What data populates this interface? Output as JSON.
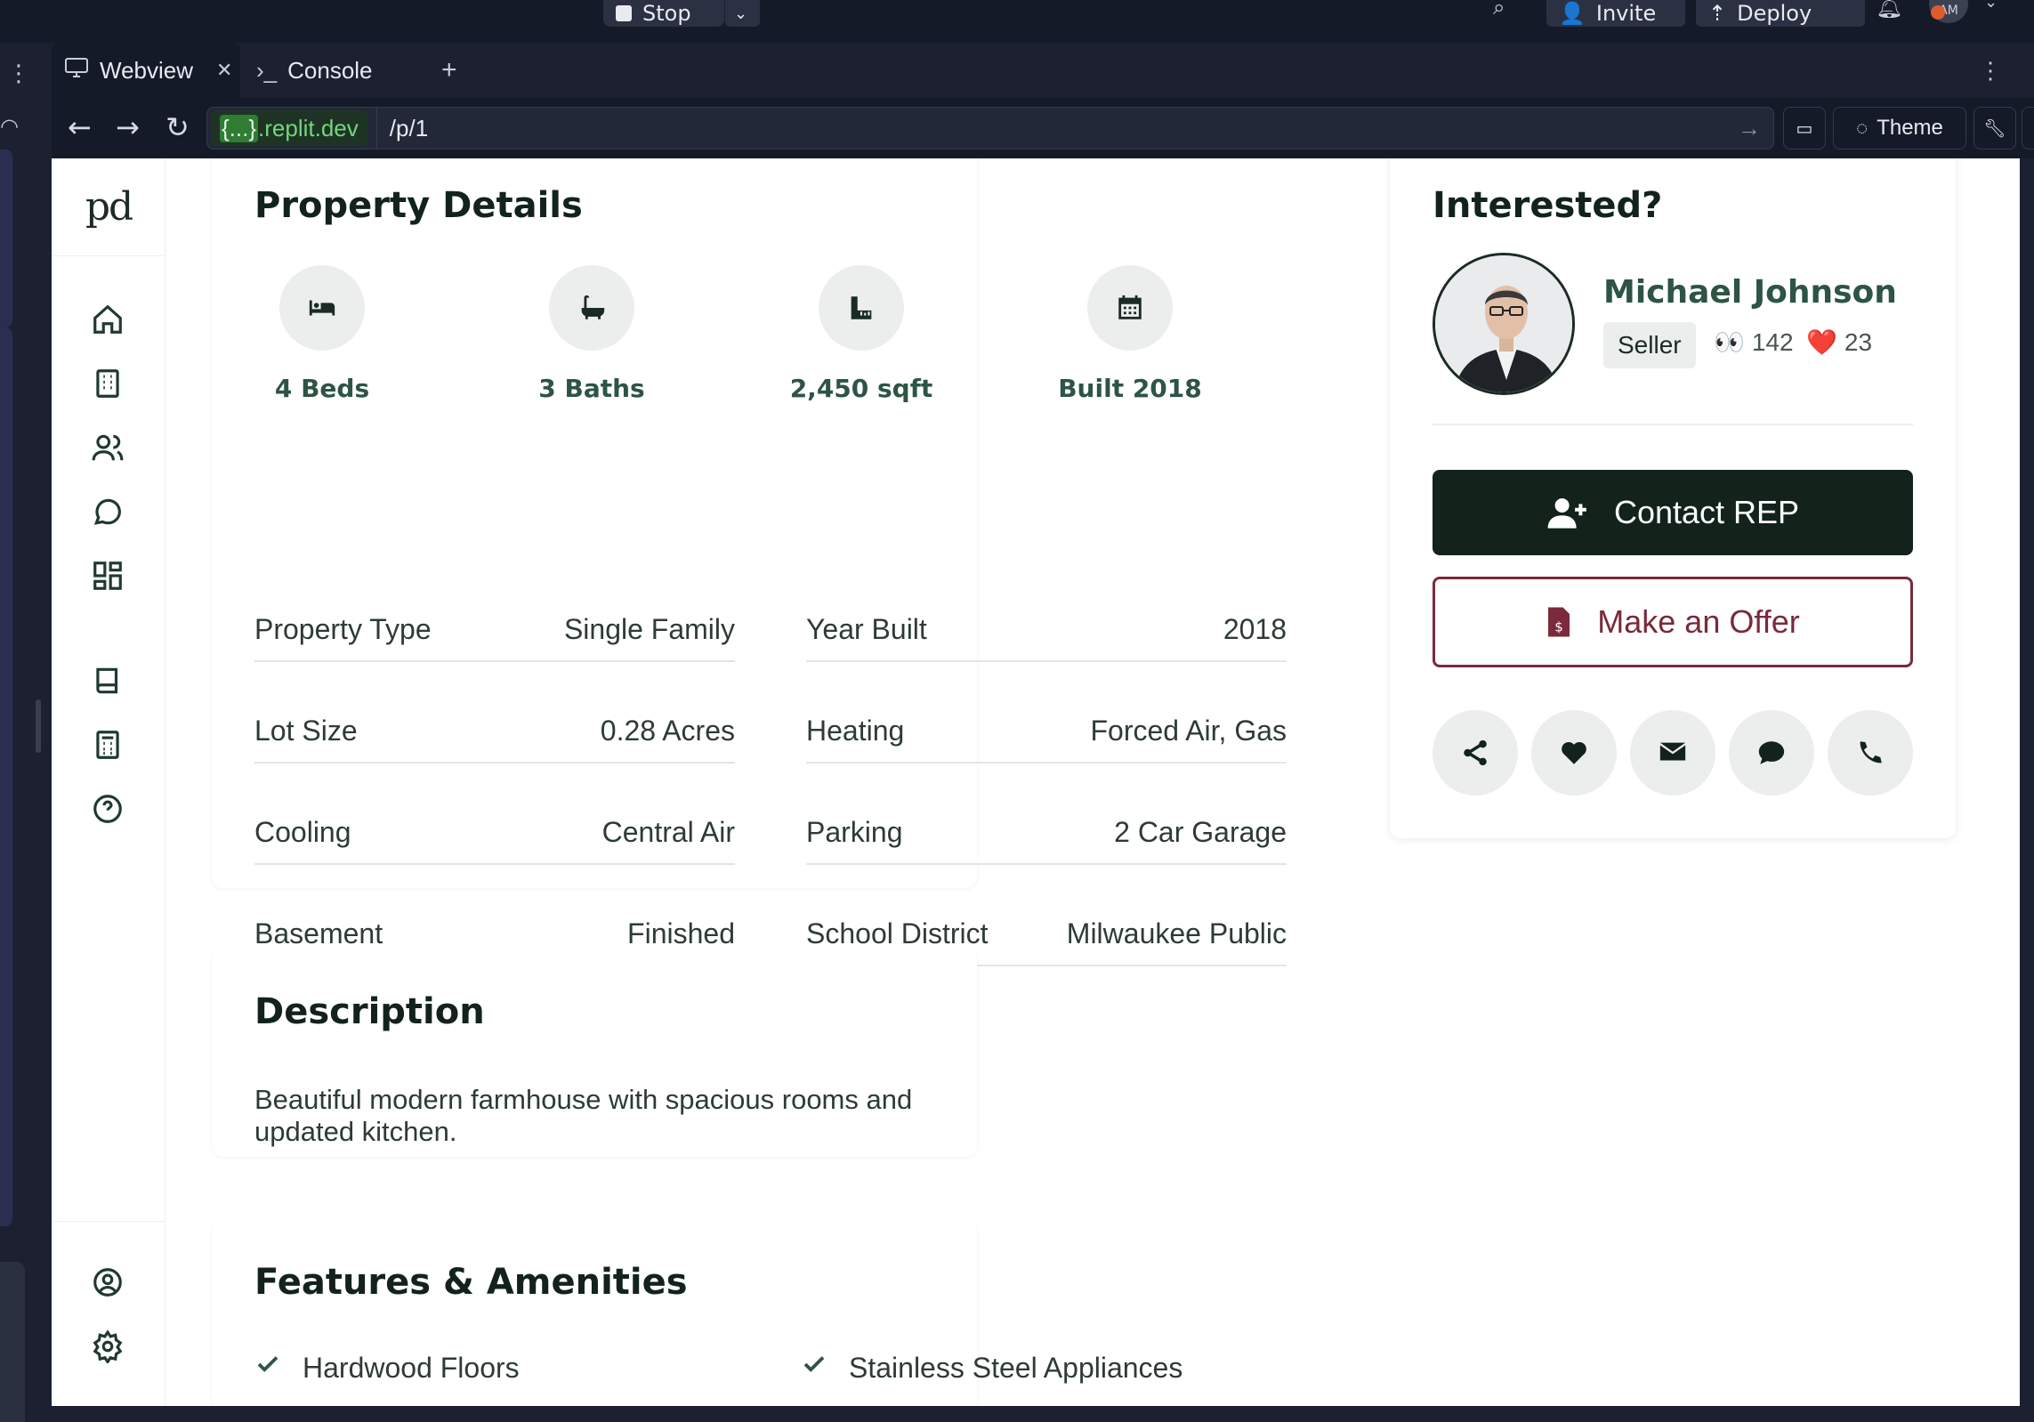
{
  "ide": {
    "stop_label": "Stop",
    "invite_label": "Invite",
    "deploy_label": "Deploy",
    "avatar_initials": "AM"
  },
  "tabs": [
    {
      "label": "Webview"
    },
    {
      "label": "Console"
    }
  ],
  "address": {
    "domain_prefix": "{...}",
    "domain_suffix": ".replit.dev",
    "path": "/p/1",
    "theme_label": "Theme"
  },
  "app": {
    "logo_text": "pd"
  },
  "property_details": {
    "title": "Property Details",
    "stats": [
      {
        "label": "4 Beds",
        "icon": "bed-icon"
      },
      {
        "label": "3 Baths",
        "icon": "bath-icon"
      },
      {
        "label": "2,450 sqft",
        "icon": "ruler-icon"
      },
      {
        "label": "Built 2018",
        "icon": "calendar-icon"
      }
    ],
    "rows": [
      {
        "label": "Property Type",
        "value": "Single Family"
      },
      {
        "label": "Year Built",
        "value": "2018"
      },
      {
        "label": "Lot Size",
        "value": "0.28 Acres"
      },
      {
        "label": "Heating",
        "value": "Forced Air, Gas"
      },
      {
        "label": "Cooling",
        "value": "Central Air"
      },
      {
        "label": "Parking",
        "value": "2 Car Garage"
      },
      {
        "label": "Basement",
        "value": "Finished"
      },
      {
        "label": "School District",
        "value": "Milwaukee Public"
      }
    ]
  },
  "description": {
    "title": "Description",
    "text": "Beautiful modern farmhouse with spacious rooms and updated kitchen."
  },
  "features": {
    "title": "Features & Amenities",
    "items": [
      "Hardwood Floors",
      "Stainless Steel Appliances"
    ]
  },
  "interested": {
    "title": "Interested?",
    "agent_name": "Michael Johnson",
    "badge": "Seller",
    "views_emoji": "👀",
    "views": "142",
    "likes_emoji": "❤️",
    "likes": "23",
    "contact_label": "Contact REP",
    "offer_label": "Make an Offer"
  },
  "colors": {
    "primary": "#13231c",
    "accent_green": "#2d5444",
    "offer_red": "#7a2a3a"
  }
}
